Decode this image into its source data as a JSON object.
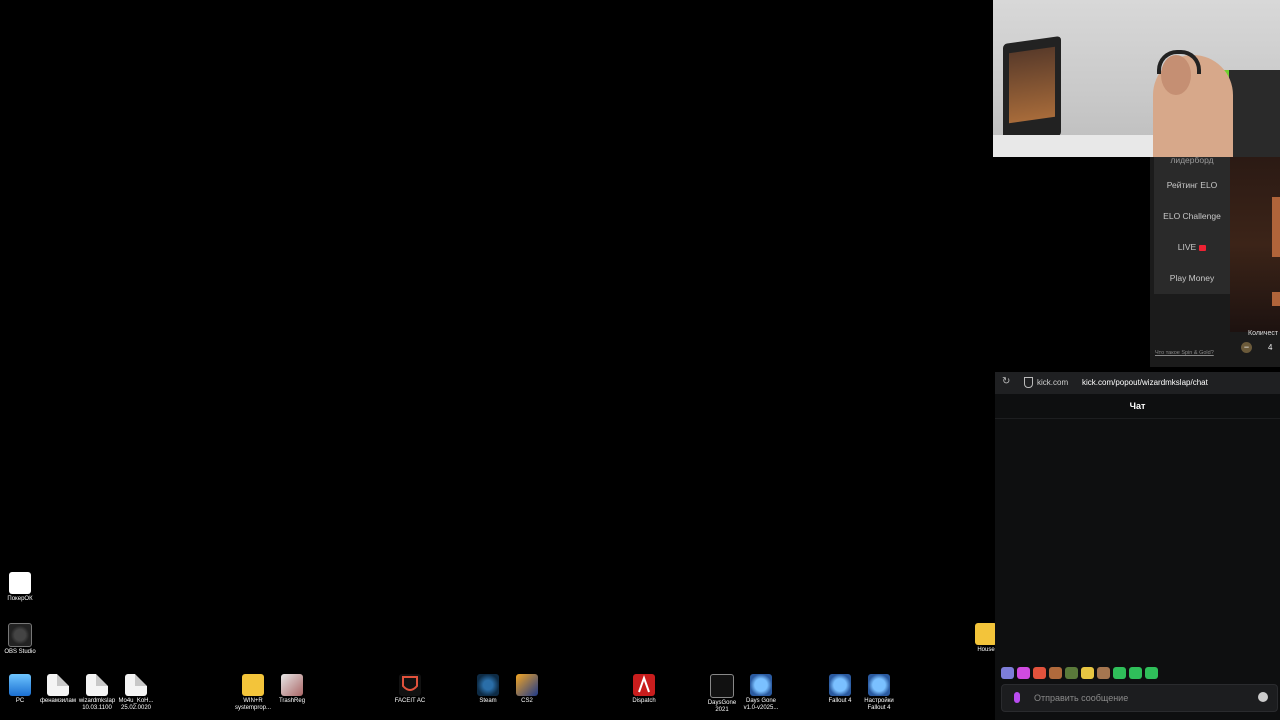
{
  "desktop": {
    "icons": [
      {
        "label": "ПокерОК",
        "icon": "pokerok-icon"
      },
      {
        "label": "OBS Studio",
        "icon": "obs-icon"
      },
      {
        "label": "PC",
        "icon": "pc-icon"
      },
      {
        "label": "фенамзилам",
        "icon": "document-icon"
      },
      {
        "label": "wizardmkslap 10.03.1100",
        "icon": "document-icon"
      },
      {
        "label": "Mo4u_KoH... 25.02.0020",
        "icon": "document-icon"
      },
      {
        "label": "WIN+R systemprop...",
        "icon": "folder-icon"
      },
      {
        "label": "TrashReg",
        "icon": "trashreg-icon"
      },
      {
        "label": "FACEIT AC",
        "icon": "faceit-icon"
      },
      {
        "label": "Steam",
        "icon": "steam-icon"
      },
      {
        "label": "CS2",
        "icon": "cs2-icon"
      },
      {
        "label": "Dispatch",
        "icon": "dispatch-icon"
      },
      {
        "label": "DaysGone 2021",
        "icon": "daysgone-icon"
      },
      {
        "label": "Days Gone v1.0-v2025...",
        "icon": "daysgone-icon"
      },
      {
        "label": "Fallout 4",
        "icon": "fallout-icon"
      },
      {
        "label": "Настройки Fallout 4",
        "icon": "fallout-icon"
      },
      {
        "label": "House",
        "icon": "folder-icon"
      }
    ]
  },
  "game_menu": {
    "items": [
      "лидерборд",
      "Рейтинг ELO",
      "ELO Challenge",
      "LIVE",
      "Play Money"
    ],
    "whatis": "Что такое Spin & Gold?",
    "count_label": "Количест",
    "qty": "4",
    "minus": "−"
  },
  "chat": {
    "site": "kick.com",
    "url": "kick.com/popout/wizardmkslap/chat",
    "header": "Чат",
    "placeholder": "Отправить сообщение",
    "emote_colors": [
      "#7d7dd8",
      "#d04be0",
      "#e2523c",
      "#b06a3c",
      "#5a7a3a",
      "#e8c642",
      "#a57650",
      "#2fbf5a",
      "#2fbf5a",
      "#2fbf5a"
    ]
  }
}
